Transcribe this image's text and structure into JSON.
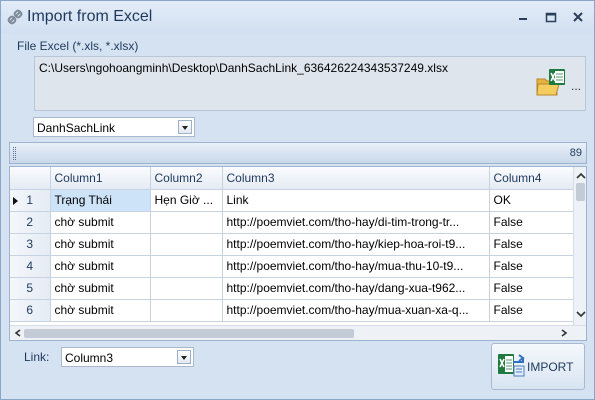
{
  "window": {
    "title": "Import from Excel"
  },
  "file": {
    "label": "File Excel (*.xls, *.xlsx)",
    "path": "C:\\Users\\ngohoangminh\\Desktop\\DanhSachLink_636426224343537249.xlsx",
    "browse_label": "..."
  },
  "sheet": {
    "selected": "DanhSachLink"
  },
  "toolbar": {
    "count": "89"
  },
  "grid": {
    "columns": [
      "",
      "Column1",
      "Column2",
      "Column3",
      "Column4"
    ],
    "rows": [
      {
        "num": "1",
        "c1": "Trạng Thái",
        "c2": "Hẹn Giờ ...",
        "c3": "Link",
        "c4": "OK"
      },
      {
        "num": "2",
        "c1": "chờ submit",
        "c2": "",
        "c3": "http://poemviet.com/tho-hay/di-tim-trong-tr...",
        "c4": "False"
      },
      {
        "num": "3",
        "c1": "chờ submit",
        "c2": "",
        "c3": "http://poemviet.com/tho-hay/kiep-hoa-roi-t9...",
        "c4": "False"
      },
      {
        "num": "4",
        "c1": "chờ submit",
        "c2": "",
        "c3": "http://poemviet.com/tho-hay/mua-thu-10-t9...",
        "c4": "False"
      },
      {
        "num": "5",
        "c1": "chờ submit",
        "c2": "",
        "c3": "http://poemviet.com/tho-hay/dang-xua-t962...",
        "c4": "False"
      },
      {
        "num": "6",
        "c1": "chờ submit",
        "c2": "",
        "c3": "http://poemviet.com/tho-hay/mua-xuan-xa-q...",
        "c4": "False"
      }
    ]
  },
  "link": {
    "label": "Link:",
    "selected": "Column3"
  },
  "import_button": {
    "label": "IMPORT"
  },
  "colors": {
    "window_bg": "#d5e2f2",
    "title_text": "#1e395b",
    "selection": "#cde3f8",
    "excel_green": "#1f7a3d"
  }
}
